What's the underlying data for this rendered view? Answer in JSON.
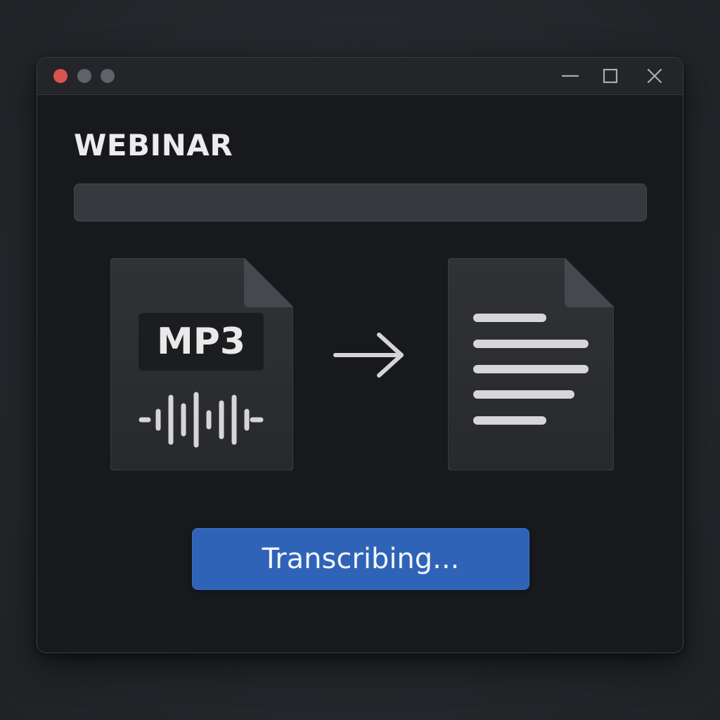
{
  "window": {
    "title": "WEBINAR",
    "controls": {
      "traffic_lights": [
        {
          "name": "close",
          "color": "#d9534f"
        },
        {
          "name": "minimize",
          "color": "#5f6268"
        },
        {
          "name": "zoom",
          "color": "#5f6268"
        }
      ],
      "right_icons": [
        "minimize-icon",
        "maximize-icon",
        "close-icon"
      ]
    }
  },
  "progress": {
    "value": 0
  },
  "conversion": {
    "source": {
      "label": "MP3",
      "icon": "audio-waveform-icon"
    },
    "arrow_icon": "arrow-right-icon",
    "target": {
      "icon": "text-document-icon"
    }
  },
  "status": {
    "label": "Transcribing..."
  },
  "colors": {
    "accent": "#2e63b7",
    "window_bg": "#17191c",
    "titlebar_bg": "#232529",
    "card_bg": "#2c2e32",
    "text": "#ececec"
  }
}
